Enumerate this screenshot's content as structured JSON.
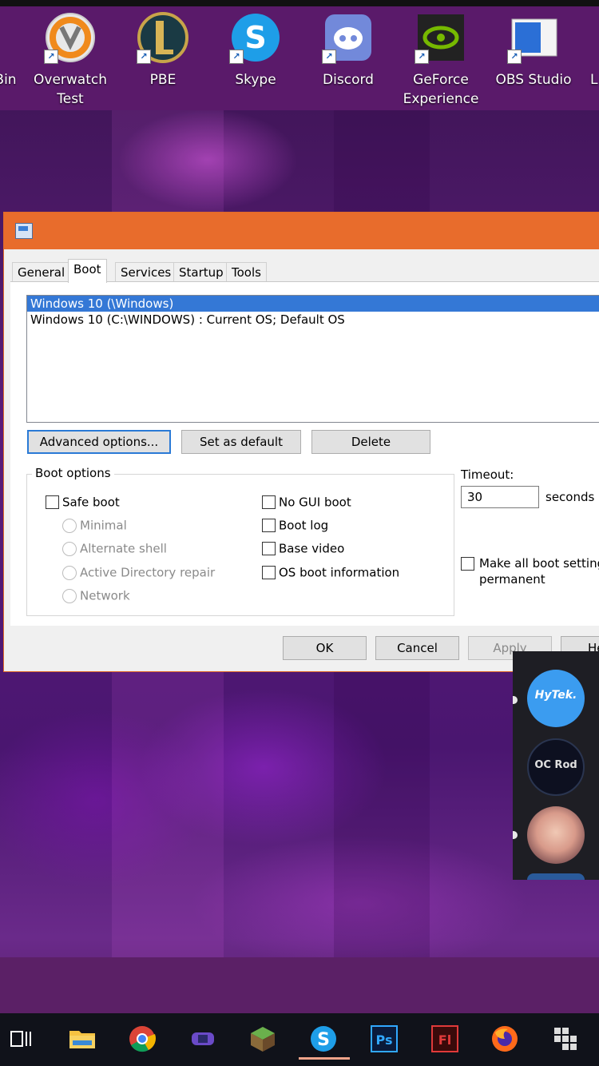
{
  "desktop": {
    "left_edge_label": "Bin",
    "right_edge_label": "L",
    "icons": [
      {
        "label_line1": "Overwatch",
        "label_line2": "Test",
        "icon": "overwatch-icon"
      },
      {
        "label_line1": "PBE",
        "label_line2": "",
        "icon": "league-pbe-icon"
      },
      {
        "label_line1": "Skype",
        "label_line2": "",
        "icon": "skype-icon"
      },
      {
        "label_line1": "Discord",
        "label_line2": "",
        "icon": "discord-icon"
      },
      {
        "label_line1": "GeForce",
        "label_line2": "Experience",
        "icon": "nvidia-icon"
      },
      {
        "label_line1": "OBS Studio",
        "label_line2": "",
        "icon": "obs-icon"
      }
    ]
  },
  "dialog": {
    "tabs": [
      "General",
      "Boot",
      "Services",
      "Startup",
      "Tools"
    ],
    "active_tab": "Boot",
    "os_list": [
      "Windows 10 (\\Windows)",
      "Windows 10 (C:\\WINDOWS) : Current OS; Default OS"
    ],
    "buttons": {
      "advanced": "Advanced options...",
      "set_default": "Set as default",
      "delete": "Delete"
    },
    "boot_options": {
      "legend": "Boot options",
      "safe_boot": "Safe boot",
      "minimal": "Minimal",
      "alternate_shell": "Alternate shell",
      "ad_repair": "Active Directory repair",
      "network": "Network",
      "no_gui_boot": "No GUI boot",
      "boot_log": "Boot log",
      "base_video": "Base video",
      "os_boot_info": "OS boot information"
    },
    "timeout": {
      "label": "Timeout:",
      "value": "30",
      "unit": "seconds"
    },
    "permanent": {
      "line1": "Make all boot settings",
      "line2": "permanent"
    },
    "footer": {
      "ok": "OK",
      "cancel": "Cancel",
      "apply": "Apply",
      "help": "He"
    }
  },
  "friends": {
    "hytek_label": "HyTek.",
    "ocrod_label": "OC Rod"
  },
  "colors": {
    "titlebar": "#e86c2c",
    "selection": "#3478d6",
    "taskbar": "#10121a"
  }
}
